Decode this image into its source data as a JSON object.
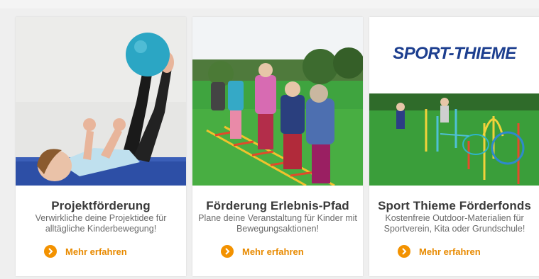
{
  "cards": [
    {
      "title": "Projektförderung",
      "description": "Verwirkliche deine Projektidee für alltägliche Kinderbewegung!",
      "link_label": "Mehr erfahren",
      "image": "child-exercise-ball-photo"
    },
    {
      "title": "Förderung Erlebnis-Pfad",
      "description": "Plane deine Veranstaltung für Kinder mit Bewegungsaktionen!",
      "link_label": "Mehr erfahren",
      "image": "children-agility-ladder-photo"
    },
    {
      "title": "Sport Thieme Förderfonds",
      "description": "Kostenfreie Outdoor-Materialien für Sportverein, Kita oder Grundschule!",
      "link_label": "Mehr erfahren",
      "image": "sports-field-equipment-photo",
      "logo_text": "SPORT-THIEME"
    }
  ],
  "colors": {
    "accent": "#f39200",
    "title": "#3a3a3a",
    "text": "#6b6b6b",
    "logo": "#1d3f8f"
  },
  "icons": {
    "link_icon": "chevron-right-circle-icon"
  }
}
